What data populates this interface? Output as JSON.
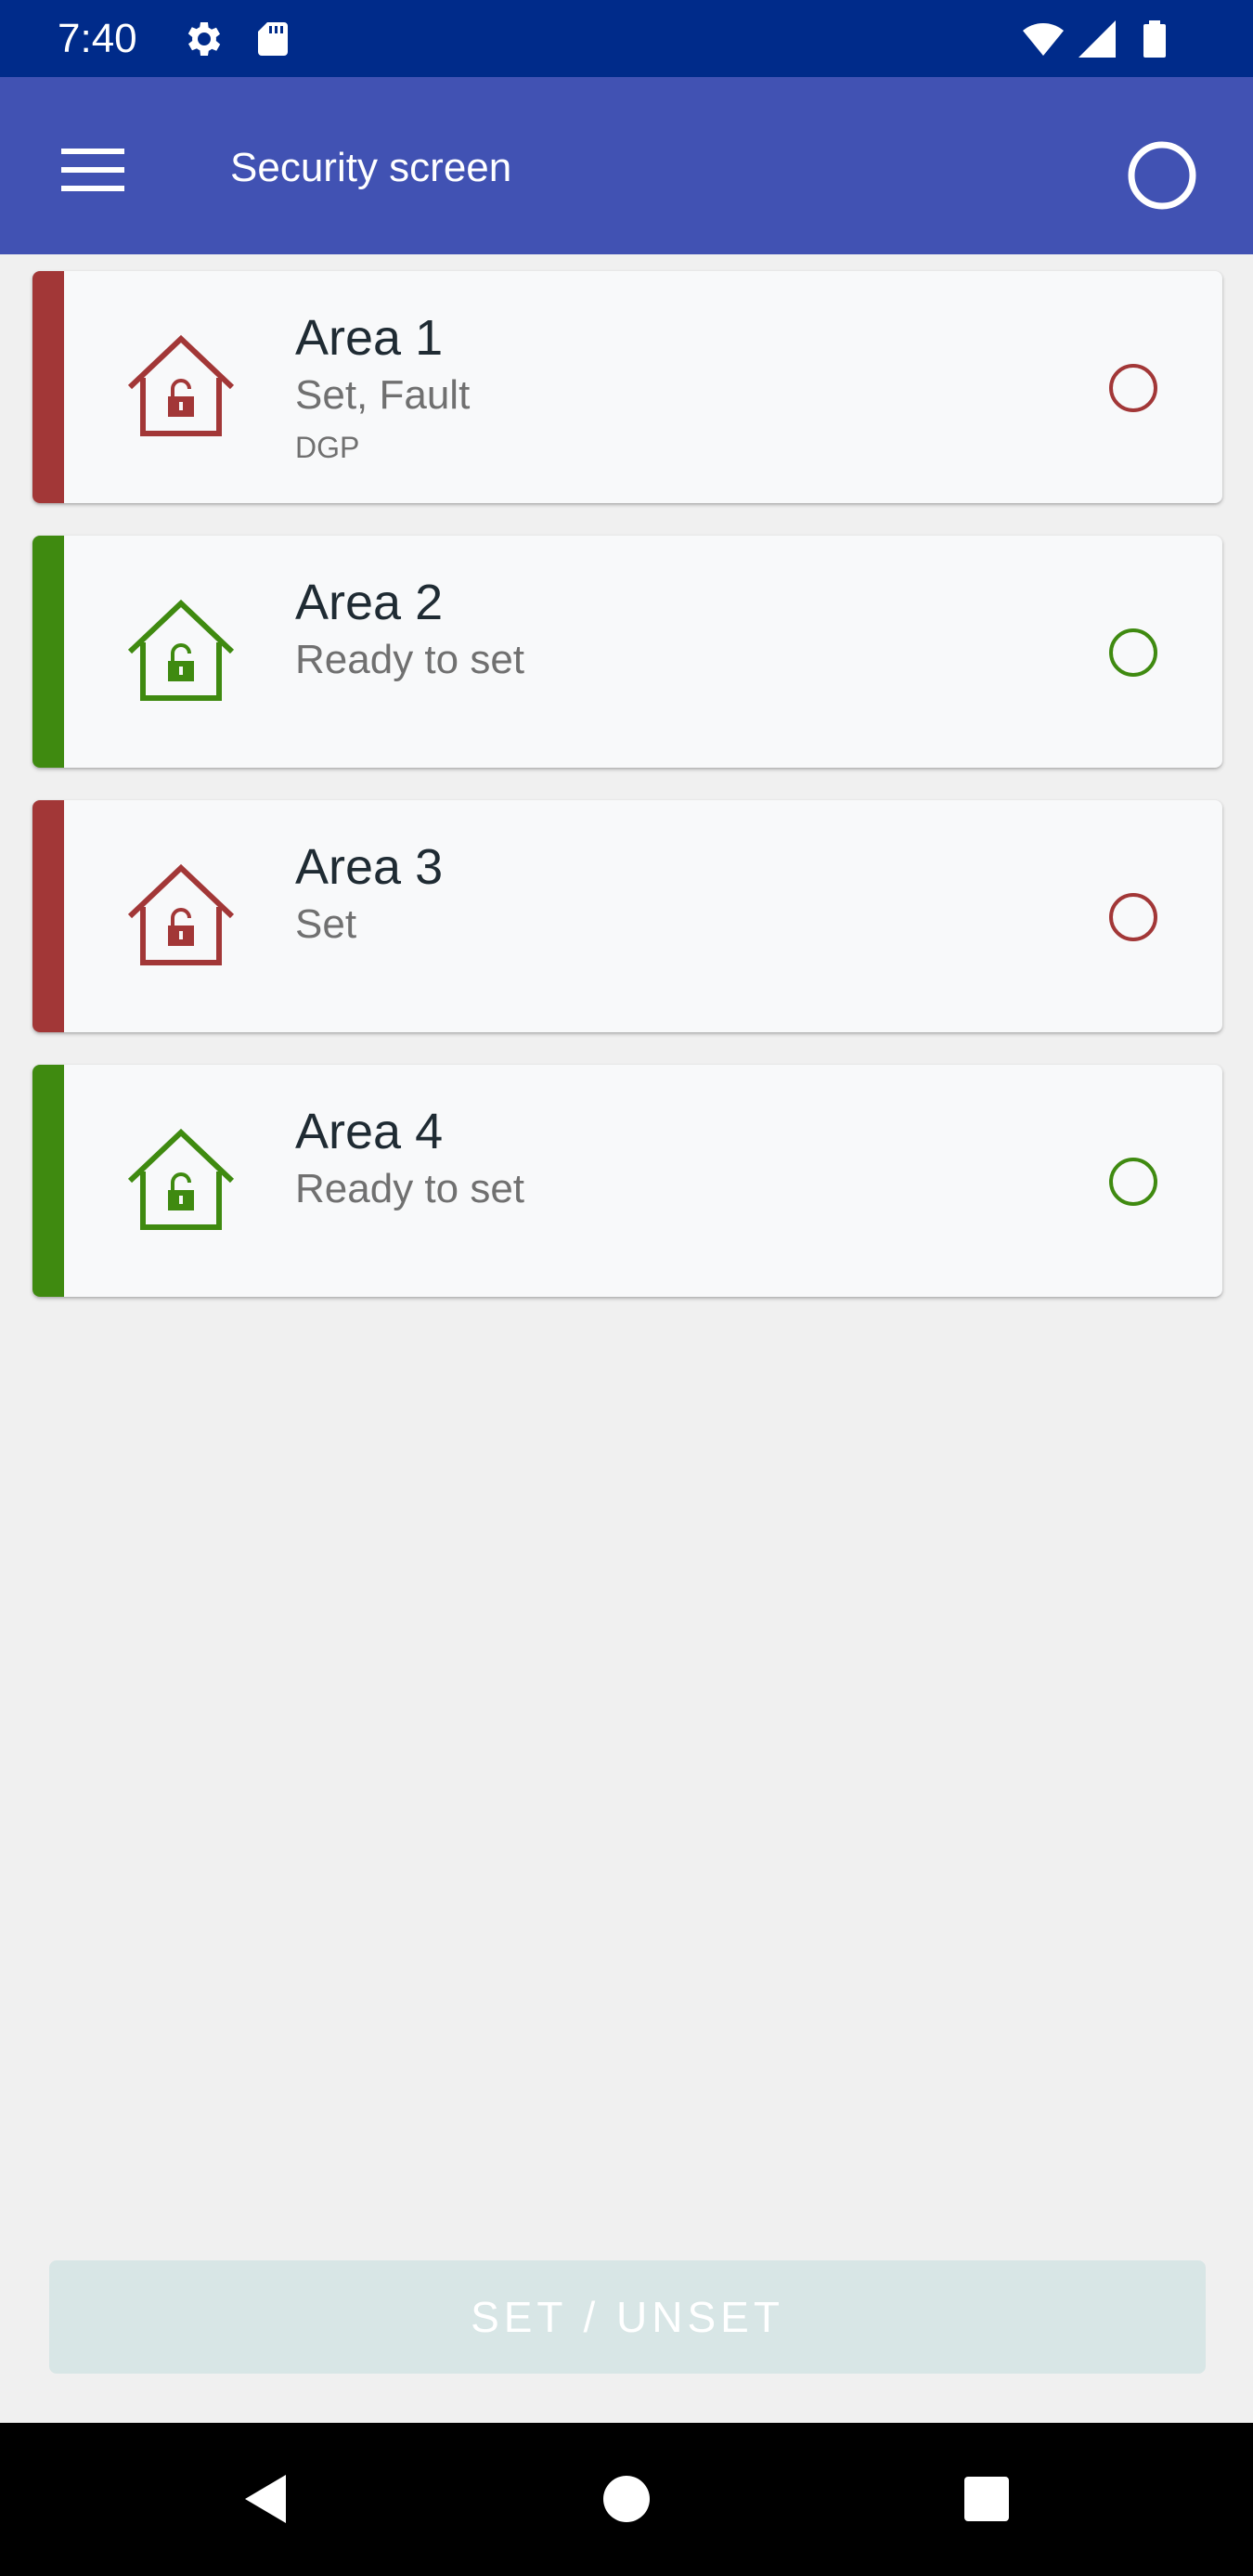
{
  "status_bar": {
    "time": "7:40",
    "icons": [
      "gear-icon",
      "sd-card-icon",
      "wifi-icon",
      "signal-icon",
      "battery-icon"
    ],
    "background": "#002b8a"
  },
  "app_bar": {
    "title": "Security screen",
    "menu_icon": "menu-icon",
    "action_icon": "circle-status-icon",
    "background": "#4152b3"
  },
  "areas": [
    {
      "name": "Area 1",
      "status": "Set, Fault",
      "detail": "DGP",
      "state": "set",
      "color": "#a23737"
    },
    {
      "name": "Area 2",
      "status": "Ready to set",
      "detail": "",
      "state": "ready",
      "color": "#3f8a10"
    },
    {
      "name": "Area 3",
      "status": "Set",
      "detail": "",
      "state": "set",
      "color": "#a23737"
    },
    {
      "name": "Area 4",
      "status": "Ready to set",
      "detail": "",
      "state": "ready",
      "color": "#3f8a10"
    }
  ],
  "set_unset_button": {
    "label": "SET / UNSET",
    "enabled": false
  },
  "nav_bar": {
    "icons": [
      "back-icon",
      "home-icon",
      "recents-icon"
    ]
  }
}
